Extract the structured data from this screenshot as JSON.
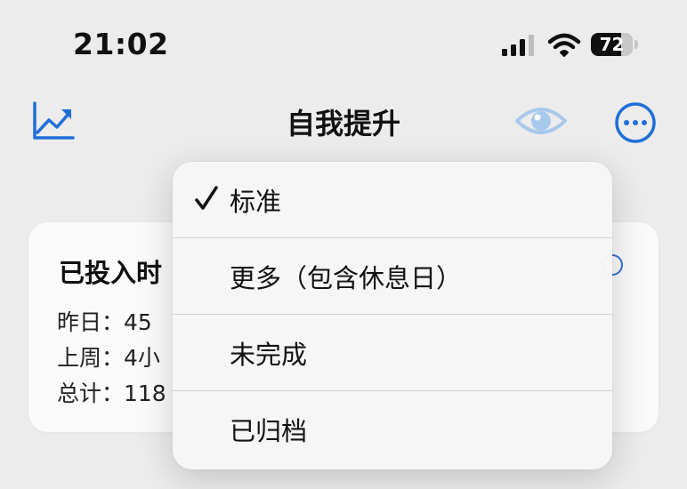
{
  "status_bar": {
    "time": "21:02",
    "battery_level": "72"
  },
  "nav": {
    "title": "自我提升",
    "left_icon": "chart-trend-icon",
    "right_icons": [
      "eye-icon",
      "more-circle-icon"
    ],
    "accent": "#1f6fd6",
    "eye_color": "#a9c9ec"
  },
  "card": {
    "title": "已投入时",
    "stats": [
      "昨日：45",
      "上周：4小",
      "总计：118"
    ]
  },
  "menu": {
    "items": [
      {
        "label": "标准",
        "checked": true
      },
      {
        "label": "更多（包含休息日）",
        "checked": false
      },
      {
        "label": "未完成",
        "checked": false
      },
      {
        "label": "已归档",
        "checked": false
      }
    ]
  }
}
